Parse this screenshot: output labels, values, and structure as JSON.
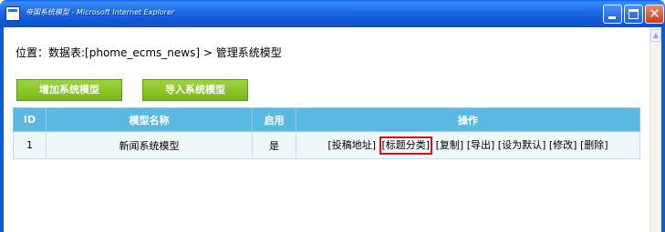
{
  "window": {
    "title": "帝国系统模型 - Microsoft Internet Explorer",
    "minimize_label": "_",
    "maximize_label": "□",
    "close_label": "✕"
  },
  "breadcrumb": {
    "prefix": "位置：数据表:[phome_ecms_news] > ",
    "current": "管理系统模型"
  },
  "buttons": {
    "add_model": "增加系统模型",
    "import_model": "导入系统模型"
  },
  "table": {
    "headers": [
      "ID",
      "模型名称",
      "启用",
      "操作"
    ],
    "rows": [
      {
        "id": "1",
        "name": "新闻系统模型",
        "enabled": "是",
        "operations": [
          "[投稿地址]",
          "[标题分类]",
          "[复制]",
          "[导出]",
          "[设为默认]",
          "[修改]",
          "[删除]"
        ]
      }
    ]
  },
  "colors": {
    "titlebar": "#1459d9",
    "button_green": "#8cc92c",
    "table_header": "#5bb8e2",
    "highlight_box": "#d31515"
  },
  "icons": {
    "app": "ie-page-icon",
    "scroll_up": "scroll-up-arrow-icon"
  }
}
